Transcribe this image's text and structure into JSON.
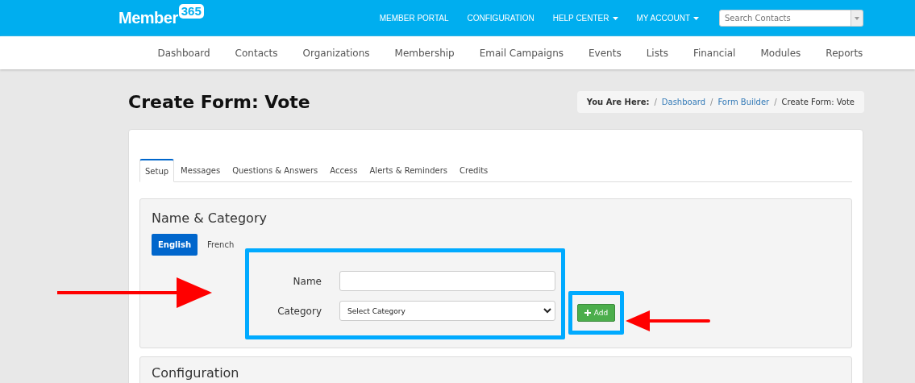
{
  "header": {
    "logo": {
      "word": "Member",
      "badge": "365"
    },
    "nav": [
      {
        "label": "MEMBER PORTAL",
        "dropdown": false
      },
      {
        "label": "CONFIGURATION",
        "dropdown": false
      },
      {
        "label": "HELP CENTER",
        "dropdown": true
      },
      {
        "label": "MY ACCOUNT",
        "dropdown": true
      }
    ],
    "search": {
      "placeholder": "Search Contacts"
    }
  },
  "main_nav": [
    "Dashboard",
    "Contacts",
    "Organizations",
    "Membership",
    "Email Campaigns",
    "Events",
    "Lists",
    "Financial",
    "Modules",
    "Reports"
  ],
  "page_title": "Create Form: Vote",
  "breadcrumb": {
    "label": "You Are Here:",
    "separator": "/",
    "items": [
      {
        "label": "Dashboard",
        "link": true
      },
      {
        "label": "Form Builder",
        "link": true
      },
      {
        "label": "Create Form: Vote",
        "link": false
      }
    ]
  },
  "tabs": [
    {
      "label": "Setup",
      "selected": true
    },
    {
      "label": "Messages",
      "selected": false
    },
    {
      "label": "Questions & Answers",
      "selected": false
    },
    {
      "label": "Access",
      "selected": false
    },
    {
      "label": "Alerts & Reminders",
      "selected": false
    },
    {
      "label": "Credits",
      "selected": false
    }
  ],
  "name_category": {
    "title": "Name & Category",
    "languages": [
      {
        "label": "English",
        "selected": true
      },
      {
        "label": "French",
        "selected": false
      }
    ],
    "fields": [
      {
        "label": "Name",
        "kind": "text"
      },
      {
        "label": "Category",
        "kind": "select",
        "value": "Select Category"
      }
    ],
    "add_button": "Add"
  },
  "configuration": {
    "title": "Configuration"
  }
}
